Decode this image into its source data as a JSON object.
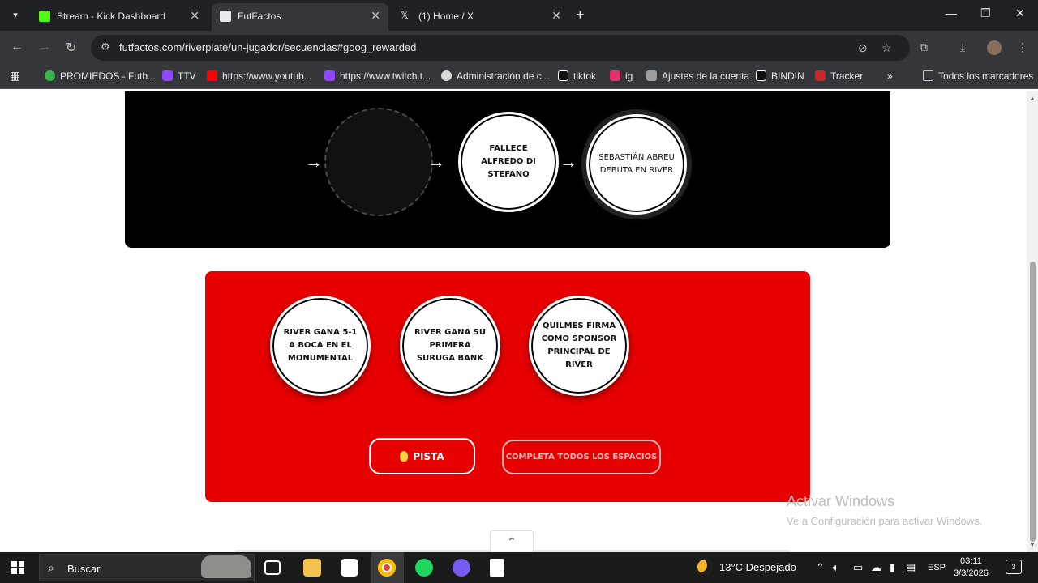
{
  "browser": {
    "tabs": [
      {
        "title": "Stream - Kick Dashboard",
        "favicon_color": "#53fc18"
      },
      {
        "title": "FutFactos",
        "favicon_color": "#ffffff"
      },
      {
        "title": "(1) Home / X",
        "favicon_color": "#e8eaed"
      }
    ],
    "url": "futfactos.com/riverplate/un-jugador/secuencias#goog_rewarded",
    "bookmarks": [
      {
        "label": "PROMIEDOS - Futb...",
        "color": "#3bb54a"
      },
      {
        "label": "TTV",
        "color": "#9146ff"
      },
      {
        "label": "https://www.youtub...",
        "color": "#ff0000"
      },
      {
        "label": "https://www.twitch.t...",
        "color": "#9146ff"
      },
      {
        "label": "Administración de c...",
        "color": "#d9d9d9"
      },
      {
        "label": "tiktok",
        "color": "#111111"
      },
      {
        "label": "ig",
        "color": "#e1306c"
      },
      {
        "label": "Ajustes de la cuenta",
        "color": "#9e9e9e"
      },
      {
        "label": "BINDIN",
        "color": "#111111"
      },
      {
        "label": "Tracker",
        "color": "#c62828"
      }
    ],
    "all_bookmarks": "Todos los marcadores"
  },
  "sequence": {
    "arrows": [
      "→",
      "→",
      "→"
    ],
    "placed": [
      "Fallece Alfredo Di Stefano",
      "Sebastián Abreu debuta en River"
    ]
  },
  "options": {
    "items": [
      "River gana 5-1 a Boca en el Monumental",
      "River gana su primera Suruga Bank",
      "Quilmes firma como sponsor principal de River"
    ],
    "hint_label": "PISTA",
    "complete_label": "COMPLETA TODOS LOS ESPACIOS"
  },
  "watermark": {
    "line1": "Activar Windows",
    "line2": "Ve a Configuración para activar Windows."
  },
  "taskbar": {
    "search": "Buscar",
    "weather": "13°C  Despejado",
    "lang": "ESP",
    "time": "03:11",
    "date": "3/3/2026",
    "notifications": "3"
  }
}
